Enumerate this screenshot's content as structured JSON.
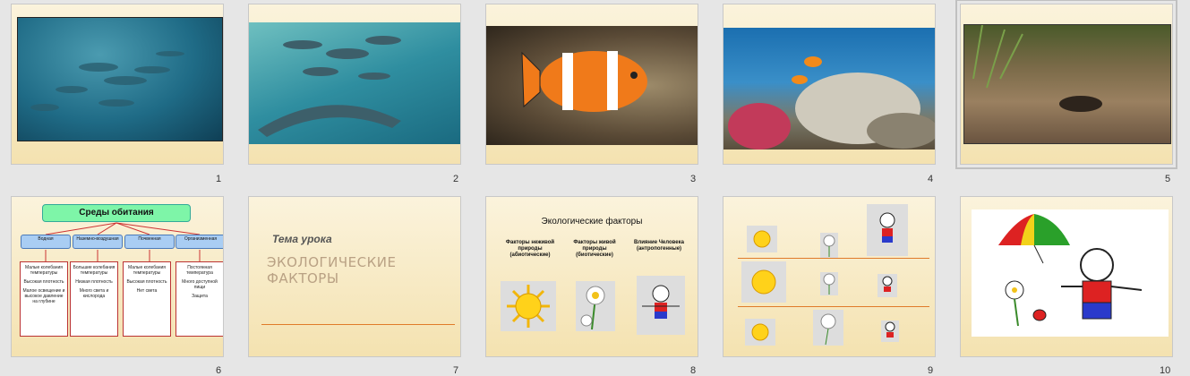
{
  "slides": [
    {
      "number": "1"
    },
    {
      "number": "2"
    },
    {
      "number": "3"
    },
    {
      "number": "4"
    },
    {
      "number": "5"
    },
    {
      "number": "6",
      "title": "Среды обитания",
      "categories": [
        "Водная",
        "Наземно-воздушная",
        "Почвенная",
        "Организменная"
      ],
      "columns": [
        [
          "Малые колебания температуры",
          "Высокая плотность",
          "Малое освещение и высокое давление на глубине"
        ],
        [
          "Большие колебания температуры",
          "Низкая плотность",
          "Много света и кислорода"
        ],
        [
          "Малые колебания температуры",
          "Высокая плотность",
          "Нет света"
        ],
        [
          "Постоянная температура",
          "Много доступной пищи",
          "Защита"
        ]
      ]
    },
    {
      "number": "7",
      "topic": "Тема урока",
      "heading": "ЭКОЛОГИЧЕСКИЕ ФАКТОРЫ"
    },
    {
      "number": "8",
      "heading": "Экологические факторы",
      "labels": [
        "Факторы неживой природы (абиотические)",
        "Факторы живой природы (биотические)",
        "Влияние Человека (антропогенные)"
      ]
    },
    {
      "number": "9"
    },
    {
      "number": "10"
    }
  ]
}
